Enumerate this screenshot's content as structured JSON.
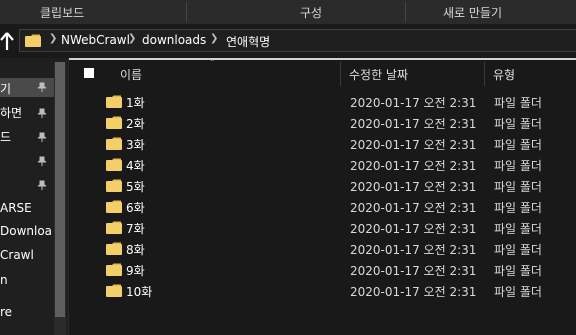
{
  "ribbon": {
    "clipboard_label": "클립보드",
    "organize_label": "구성",
    "new_label": "새로 만들기"
  },
  "address": {
    "crumbs": [
      "NWebCrawl",
      "downloads",
      "연애혁명"
    ]
  },
  "nav": {
    "items": [
      {
        "label": "기",
        "selected": true,
        "pinned": true
      },
      {
        "label": "하면",
        "selected": false,
        "pinned": true
      },
      {
        "label": "드",
        "selected": false,
        "pinned": true
      },
      {
        "label": "",
        "selected": false,
        "pinned": true
      },
      {
        "label": "",
        "selected": false,
        "pinned": true
      },
      {
        "label": "ARSE",
        "selected": false,
        "pinned": false
      },
      {
        "label": "Downloa",
        "selected": false,
        "pinned": false
      },
      {
        "label": "Crawl",
        "selected": false,
        "pinned": false
      },
      {
        "label": "n",
        "selected": false,
        "pinned": false
      },
      {
        "label": "",
        "selected": false,
        "pinned": false
      },
      {
        "label": "re",
        "selected": false,
        "pinned": false
      }
    ]
  },
  "list": {
    "columns": {
      "name": "이름",
      "date": "수정한 날짜",
      "type": "유형"
    },
    "rows": [
      {
        "name": "1화",
        "date": "2020-01-17 오전 2:31",
        "type": "파일 폴더"
      },
      {
        "name": "2화",
        "date": "2020-01-17 오전 2:31",
        "type": "파일 폴더"
      },
      {
        "name": "3화",
        "date": "2020-01-17 오전 2:31",
        "type": "파일 폴더"
      },
      {
        "name": "4화",
        "date": "2020-01-17 오전 2:31",
        "type": "파일 폴더"
      },
      {
        "name": "5화",
        "date": "2020-01-17 오전 2:31",
        "type": "파일 폴더"
      },
      {
        "name": "6화",
        "date": "2020-01-17 오전 2:31",
        "type": "파일 폴더"
      },
      {
        "name": "7화",
        "date": "2020-01-17 오전 2:31",
        "type": "파일 폴더"
      },
      {
        "name": "8화",
        "date": "2020-01-17 오전 2:31",
        "type": "파일 폴더"
      },
      {
        "name": "9화",
        "date": "2020-01-17 오전 2:31",
        "type": "파일 폴더"
      },
      {
        "name": "10화",
        "date": "2020-01-17 오전 2:31",
        "type": "파일 폴더"
      }
    ]
  },
  "colors": {
    "background": "#191919",
    "folder": "#f3cf6a",
    "folder_tab": "#e8b84a"
  },
  "icons": [
    "up-arrow-icon",
    "folder-icon",
    "chevron-right-icon",
    "pin-icon",
    "sort-up-icon"
  ]
}
